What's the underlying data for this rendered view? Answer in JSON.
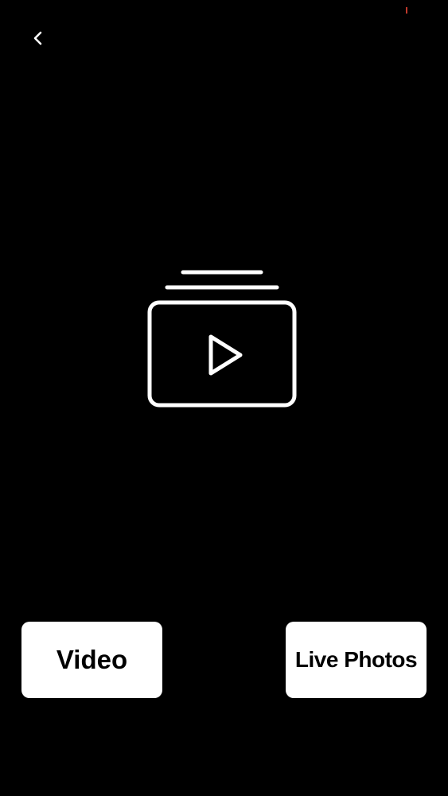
{
  "header": {
    "back_icon": "chevron-left-icon"
  },
  "hero": {
    "icon": "video-library-icon"
  },
  "actions": {
    "video_label": "Video",
    "live_photos_label": "Live Photos"
  },
  "colors": {
    "background": "#000000",
    "button_bg": "#ffffff",
    "button_text": "#000000",
    "icon_stroke": "#ffffff",
    "status_mark": "#c0392b"
  }
}
